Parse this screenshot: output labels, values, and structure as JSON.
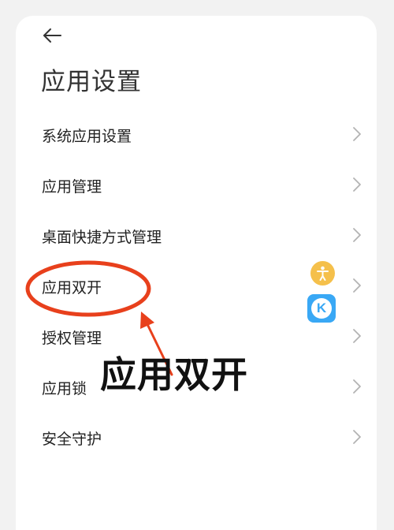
{
  "header": {
    "back_icon": "arrow-left-icon",
    "title": "应用设置"
  },
  "menu": {
    "items": [
      {
        "label": "系统应用设置",
        "icon": "chevron-right-icon"
      },
      {
        "label": "应用管理",
        "icon": "chevron-right-icon"
      },
      {
        "label": "桌面快捷方式管理",
        "icon": "chevron-right-icon"
      },
      {
        "label": "应用双开",
        "icon": "chevron-right-icon"
      },
      {
        "label": "授权管理",
        "icon": "chevron-right-icon"
      },
      {
        "label": "应用锁",
        "icon": "chevron-right-icon"
      },
      {
        "label": "安全守护",
        "icon": "chevron-right-icon"
      }
    ]
  },
  "floating_ball": {
    "top_icon": "accessibility-icon",
    "bottom_icon": "kugou-app-icon",
    "bottom_letter": "K"
  },
  "annotation": {
    "callout_text": "应用双开",
    "ring_color": "#e8401c",
    "arrow_color": "#e8401c"
  },
  "colors": {
    "text_primary": "#222222",
    "chevron": "#b3b3b3",
    "float_orange": "#f5c04b",
    "float_blue": "#39a8f5"
  }
}
